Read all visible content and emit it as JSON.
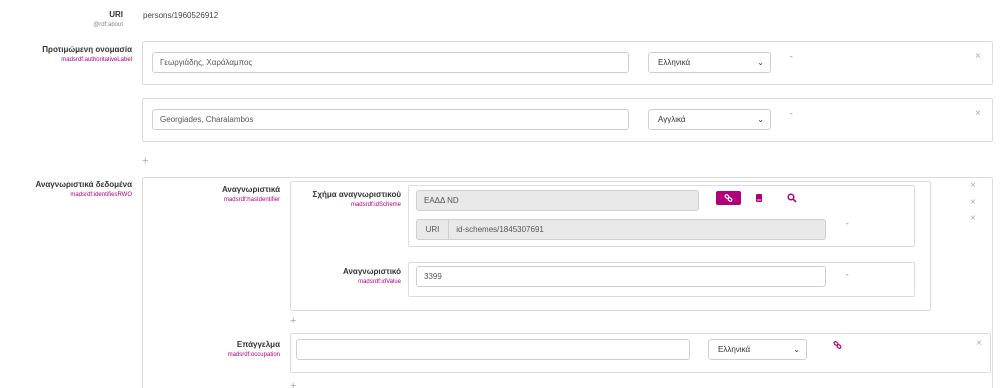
{
  "uri": {
    "label": "URI",
    "sub": "@rdf:about",
    "value": "persons/1960526912"
  },
  "preferred_name": {
    "label": "Προτιμώμενη ονομασία",
    "sub": "madsrdf:authoritativeLabel",
    "entries": [
      {
        "value": "Γεωργιάδης, Χαράλαμπος",
        "language": "Ελληνικά",
        "dash": "-"
      },
      {
        "value": "Georgiades, Charalambos",
        "language": "Αγγλικά",
        "dash": "-"
      }
    ]
  },
  "identifiers_data": {
    "label": "Αναγνωριστικά δεδομένα",
    "sub": "madsrdf:identifiesRWO",
    "identifiers": {
      "label": "Αναγνωριστικά",
      "sub": "madsrdf:hasIdentifier",
      "scheme": {
        "label": "Σχήμα αναγνωριστικού",
        "sub": "madsrdf:idScheme",
        "value": "ΕΑΔΔ ND",
        "uri_prefix": "URI",
        "uri_value": "id-schemes/1845307691",
        "dash": "-"
      },
      "id_value": {
        "label": "Αναγνωριστικό",
        "sub": "madsrdf:idValue",
        "value": "3399",
        "dash": "-"
      }
    },
    "occupation": {
      "label": "Επάγγελμα",
      "sub": "madsrdf:occupation",
      "value": "",
      "language": "Ελληνικά"
    }
  },
  "icons": {
    "remove": "×",
    "add": "+",
    "caret": "⌃⌄"
  },
  "colors": {
    "accent": "#b0007a"
  }
}
